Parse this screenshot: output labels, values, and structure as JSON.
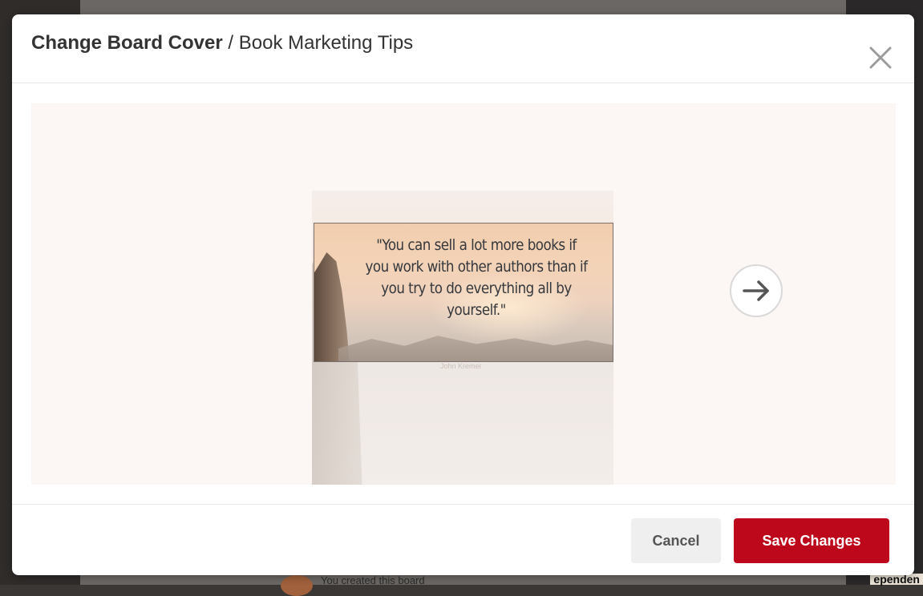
{
  "modal": {
    "title_strong": "Change Board Cover",
    "title_separator": " / ",
    "title_board": "Book Marketing Tips",
    "close_icon": "close-icon"
  },
  "cover": {
    "quote": "\"You can sell a lot more books if\nyou work with other authors than if\nyou try to do everything all by\nyourself.\"",
    "author": "John Kremer",
    "next_icon": "arrow-right-icon"
  },
  "footer": {
    "cancel_label": "Cancel",
    "save_label": "Save Changes"
  },
  "backdrop": {
    "activity_text": "You created this board",
    "right_text": "ependen"
  },
  "colors": {
    "accent": "#bd081c",
    "cover_bg": "#fcf6f4"
  }
}
